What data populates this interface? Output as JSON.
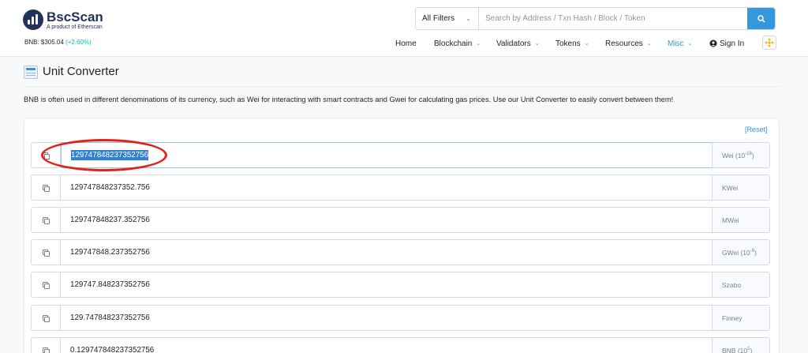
{
  "header": {
    "logo_name": "BscScan",
    "logo_sub": "A product of Etherscan",
    "price_label": "BNB: $305.04",
    "price_change": "(+2.60%)",
    "search_filter": "All Filters",
    "search_placeholder": "Search by Address / Txn Hash / Block / Token",
    "nav": {
      "home": "Home",
      "blockchain": "Blockchain",
      "validators": "Validators",
      "tokens": "Tokens",
      "resources": "Resources",
      "misc": "Misc",
      "sign_in": "Sign In"
    }
  },
  "page": {
    "title": "Unit Converter",
    "description": "BNB is often used in different denominations of its currency, such as Wei for interacting with smart contracts and Gwei for calculating gas prices. Use our Unit Converter to easily convert between them!",
    "reset_label": "[Reset]"
  },
  "rows": [
    {
      "value": "129747848237352756",
      "unit": "Wei",
      "exp": "-18",
      "selected": true
    },
    {
      "value": "129747848237352.756",
      "unit": "KWei",
      "exp": ""
    },
    {
      "value": "129747848237.352756",
      "unit": "MWei",
      "exp": ""
    },
    {
      "value": "129747848.237352756",
      "unit": "GWei",
      "exp": "-9"
    },
    {
      "value": "129747.848237352756",
      "unit": "Szabo",
      "exp": ""
    },
    {
      "value": "129.747848237352756",
      "unit": "Finney",
      "exp": ""
    },
    {
      "value": "0.129747848237352756",
      "unit": "BNB",
      "exp": "1"
    }
  ],
  "colors": {
    "accent": "#3498db",
    "annotation": "#e2231a",
    "price_up": "#00c9a7",
    "brand": "#21325b"
  },
  "icons": [
    "bscscan-logo-icon",
    "chevron-down-icon",
    "search-icon",
    "user-circle-icon",
    "bnb-icon",
    "unit-converter-icon",
    "copy-icon"
  ]
}
